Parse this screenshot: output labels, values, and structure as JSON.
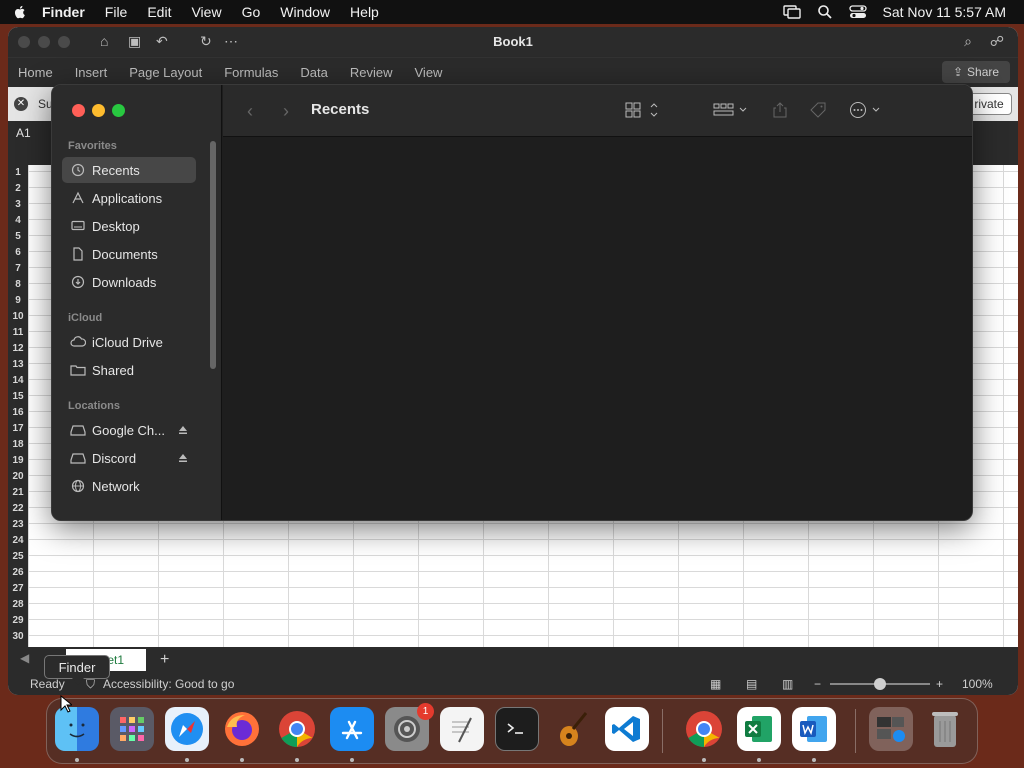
{
  "menubar": {
    "app_name": "Finder",
    "items": [
      "File",
      "Edit",
      "View",
      "Go",
      "Window",
      "Help"
    ],
    "clock": "Sat Nov 11  5:57 AM"
  },
  "excel": {
    "title": "Book1",
    "ribbon_tabs": [
      "Home",
      "Insert",
      "Page Layout",
      "Formulas",
      "Data",
      "Review",
      "View"
    ],
    "share_label": "Share",
    "message_partial": "Su",
    "private_button_partial": "rivate",
    "cell_ref": "A1",
    "row_numbers": [
      "1",
      "2",
      "3",
      "4",
      "5",
      "6",
      "7",
      "8",
      "9",
      "10",
      "11",
      "12",
      "13",
      "14",
      "15",
      "16",
      "17",
      "18",
      "19",
      "20",
      "21",
      "22",
      "23",
      "24",
      "25",
      "26",
      "27",
      "28",
      "29",
      "30"
    ],
    "sheet_tab_partial": "et1",
    "add_sheet": "+",
    "status_ready": "Ready",
    "status_accessibility": "Accessibility: Good to go",
    "zoom_minus": "−",
    "zoom_plus": "+",
    "zoom_level": "100%"
  },
  "finder": {
    "title": "Recents",
    "sections": {
      "favorites": "Favorites",
      "icloud": "iCloud",
      "locations": "Locations"
    },
    "favorites": [
      "Recents",
      "Applications",
      "Desktop",
      "Documents",
      "Downloads"
    ],
    "icloud_items": [
      "iCloud Drive",
      "Shared"
    ],
    "location_items": [
      "Google Ch...",
      "Discord",
      "Network"
    ]
  },
  "tooltip": {
    "label": "Finder"
  },
  "dock": {
    "apps": [
      "finder",
      "launchpad",
      "safari",
      "firefox",
      "chrome",
      "app-store",
      "system-settings",
      "textedit",
      "terminal",
      "garageband",
      "vscode",
      "chrome",
      "excel",
      "word",
      "app-store-folder",
      "trash"
    ],
    "settings_badge": "1"
  }
}
